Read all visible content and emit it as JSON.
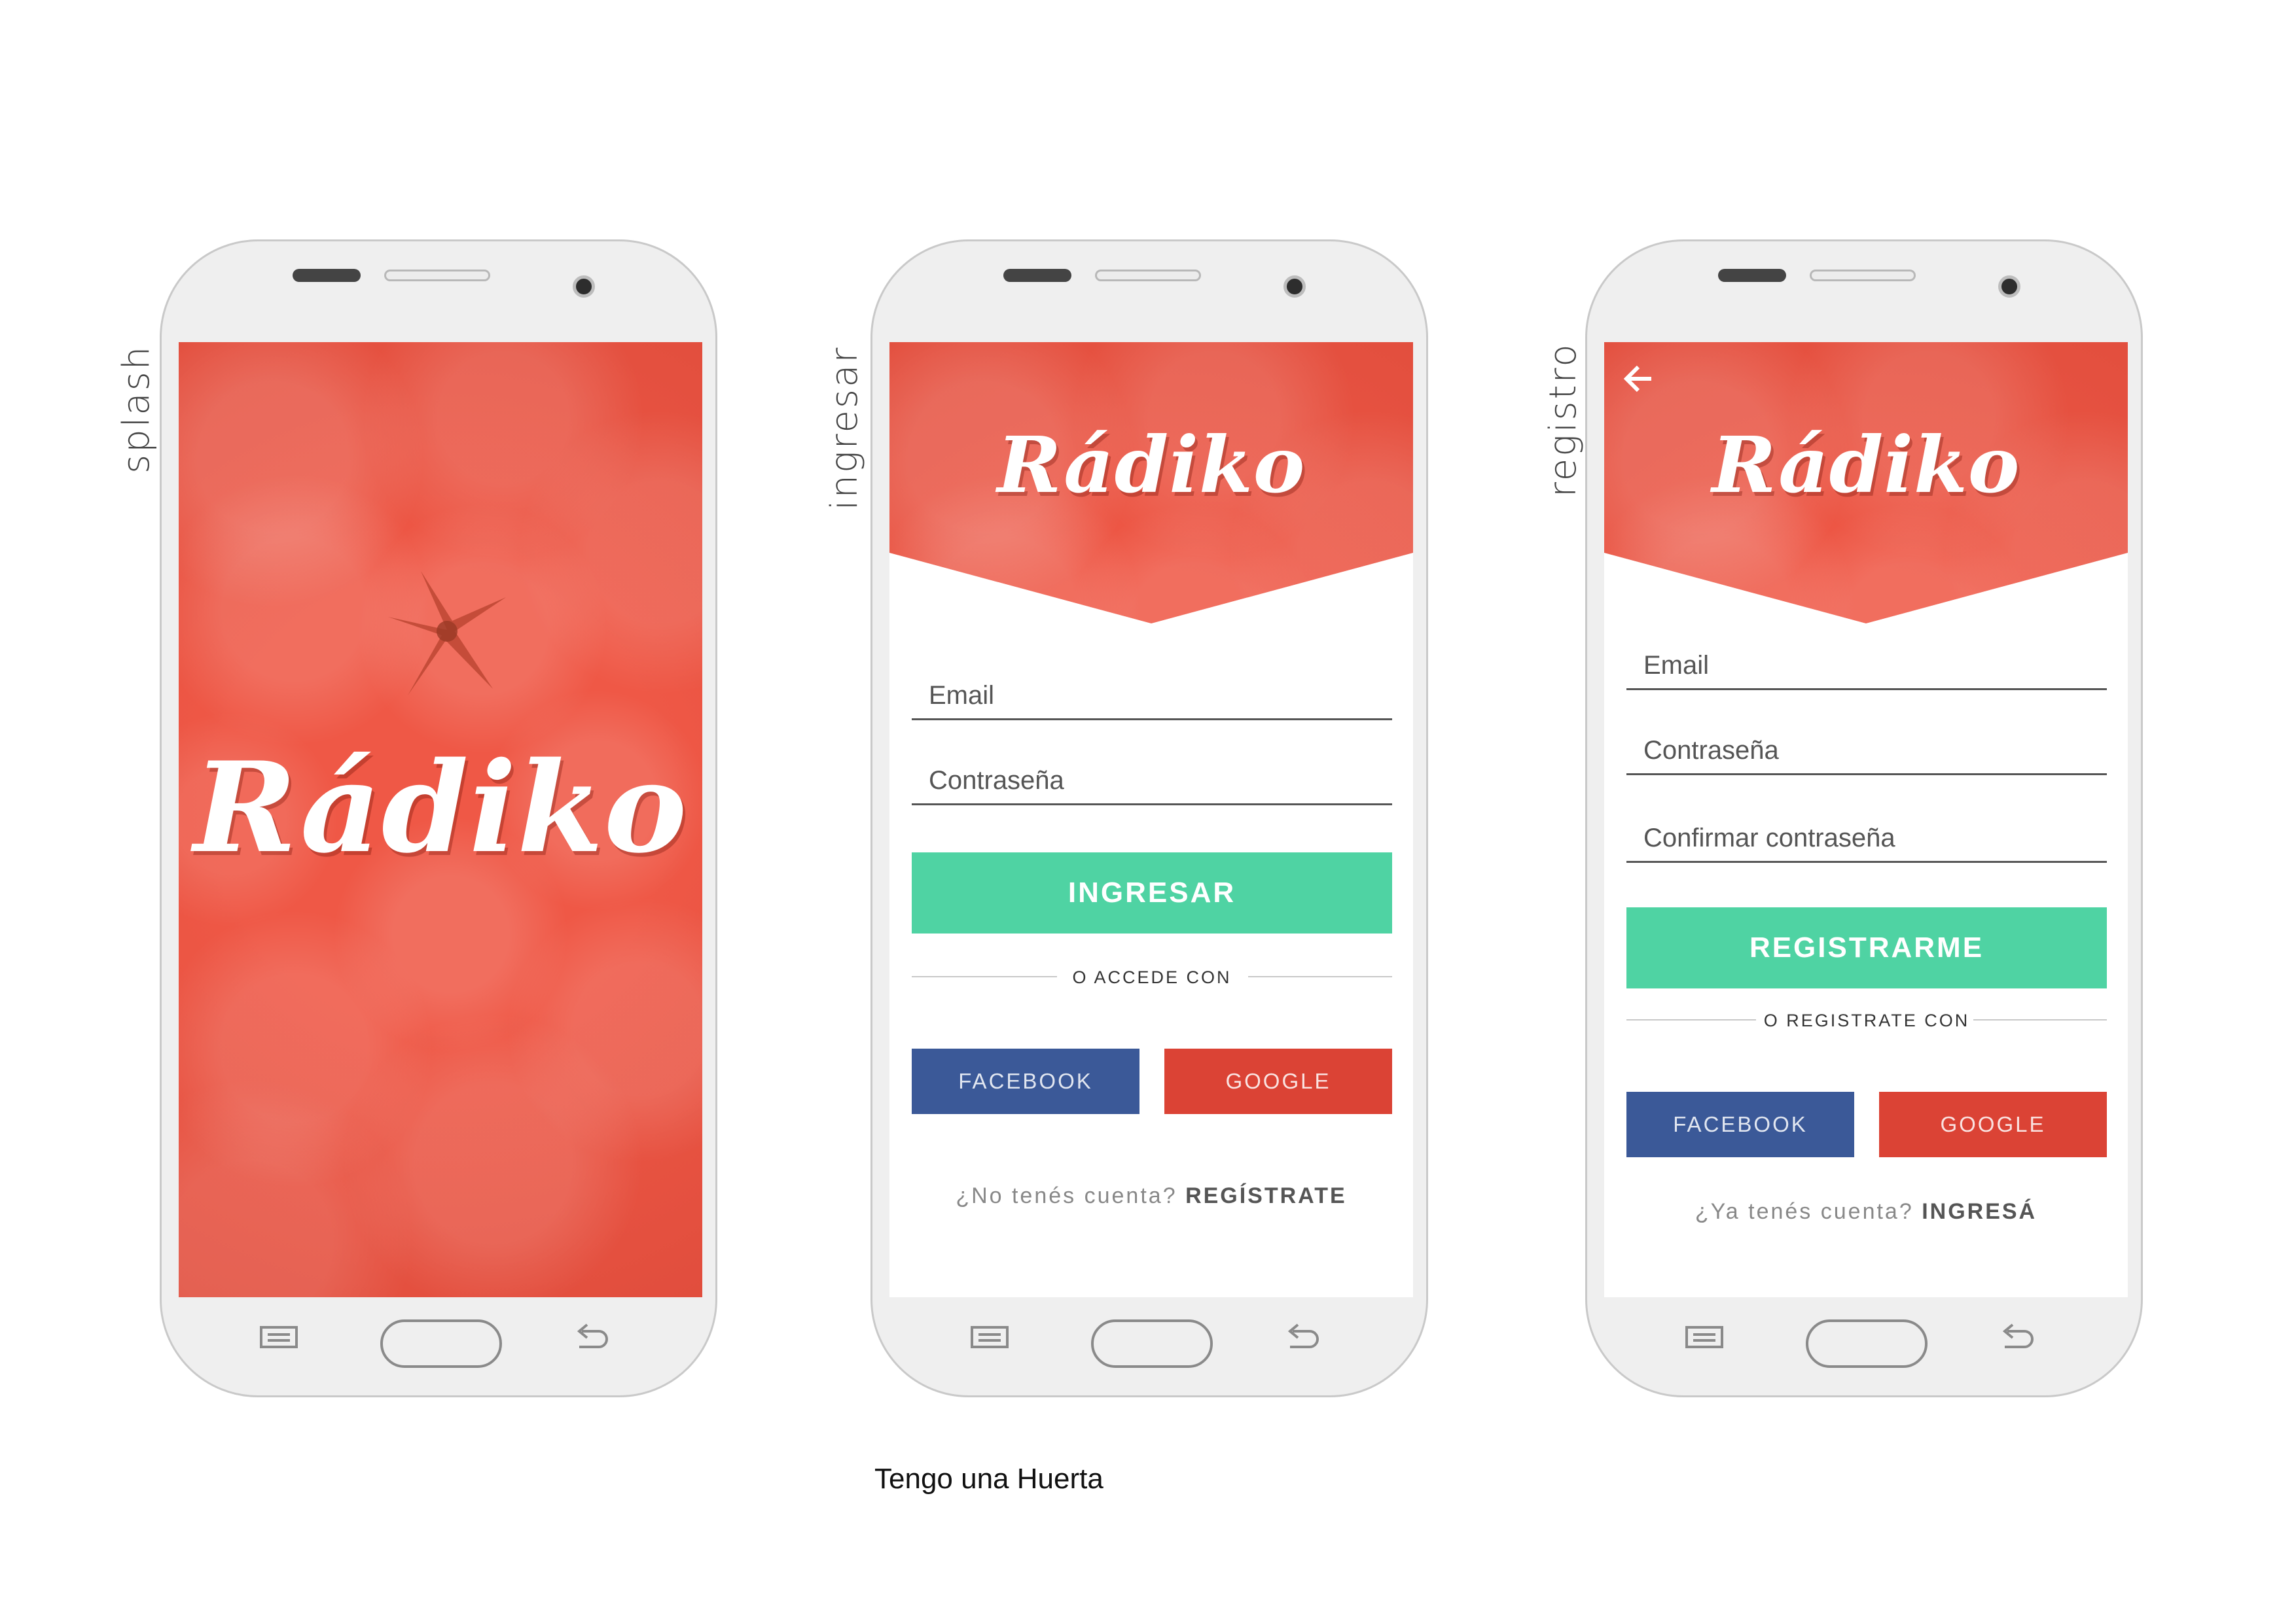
{
  "app_name": "Rádiko",
  "colors": {
    "primary": "#ef5846",
    "cta": "#4fd3a3",
    "facebook": "#3b5998",
    "google": "#db4335"
  },
  "screens": {
    "splash": {
      "label": "splash",
      "logo": "Rádiko"
    },
    "ingresar": {
      "label": "ingresar",
      "logo": "Rádiko",
      "email_placeholder": "Email",
      "password_placeholder": "Contraseña",
      "submit_label": "INGRESAR",
      "divider_text": "O ACCEDE CON",
      "facebook_label": "FACEBOOK",
      "google_label": "GOOGLE",
      "footer_prompt": "¿No tenés cuenta?",
      "footer_link": "REGÍSTRATE"
    },
    "registro": {
      "label": "registro",
      "logo": "Rádiko",
      "back_icon": "arrow-left-icon",
      "email_placeholder": "Email",
      "password_placeholder": "Contraseña",
      "confirm_placeholder": "Confirmar contraseña",
      "submit_label": "REGISTRARME",
      "divider_text": "O REGISTRATE CON",
      "facebook_label": "FACEBOOK",
      "google_label": "GOOGLE",
      "footer_prompt": "¿Ya tenés cuenta?",
      "footer_link": "INGRESÁ"
    }
  },
  "caption": "Tengo una Huerta"
}
